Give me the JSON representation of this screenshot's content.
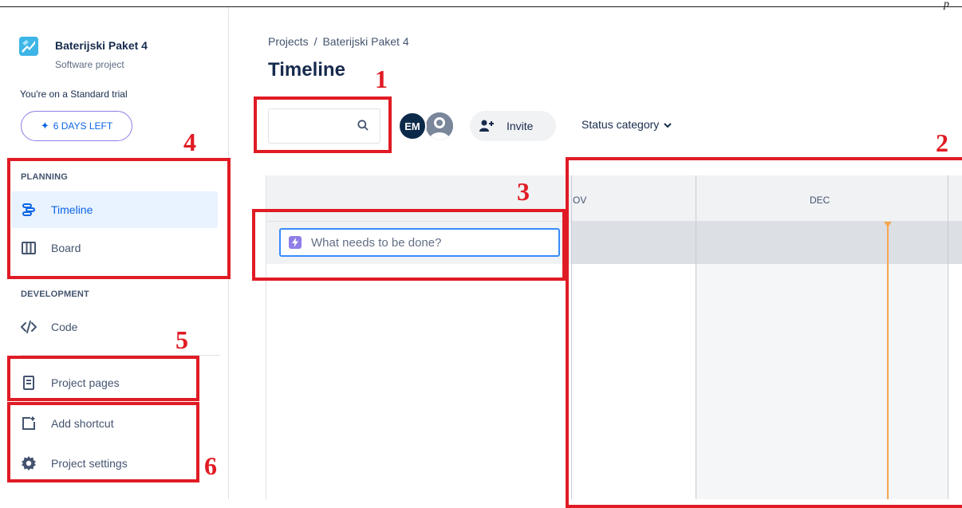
{
  "project": {
    "name": "Baterijski Paket 4",
    "type": "Software project",
    "trial_text": "You're on a Standard trial",
    "days_left_label": "6 DAYS LEFT"
  },
  "sidebar": {
    "planning_header": "PLANNING",
    "planning_items": [
      {
        "label": "Timeline",
        "icon": "timeline-icon",
        "active": true
      },
      {
        "label": "Board",
        "icon": "board-icon",
        "active": false
      }
    ],
    "development_header": "DEVELOPMENT",
    "development_items": [
      {
        "label": "Code",
        "icon": "code-icon"
      }
    ],
    "bottom_items": [
      {
        "label": "Project pages",
        "icon": "page-icon"
      },
      {
        "label": "Add shortcut",
        "icon": "add-shortcut-icon"
      },
      {
        "label": "Project settings",
        "icon": "gear-icon"
      }
    ]
  },
  "header": {
    "breadcrumb": [
      "Projects",
      "Baterijski Paket 4"
    ],
    "breadcrumb_separator": "/",
    "title": "Timeline"
  },
  "toolbar": {
    "search_value": "",
    "avatar_initials": "EM",
    "invite_label": "Invite",
    "status_category_label": "Status category"
  },
  "timeline": {
    "months": [
      "OV",
      "DEC"
    ],
    "create_placeholder": "What needs to be done?"
  },
  "annotations": [
    "1",
    "2",
    "3",
    "4",
    "5",
    "6"
  ],
  "colors": {
    "accent": "#0c66e4",
    "active_bg": "#e9f2ff",
    "annotation_red": "#e01b24",
    "today_line": "#f5a64f",
    "epic_purple": "#8f7ee7"
  }
}
